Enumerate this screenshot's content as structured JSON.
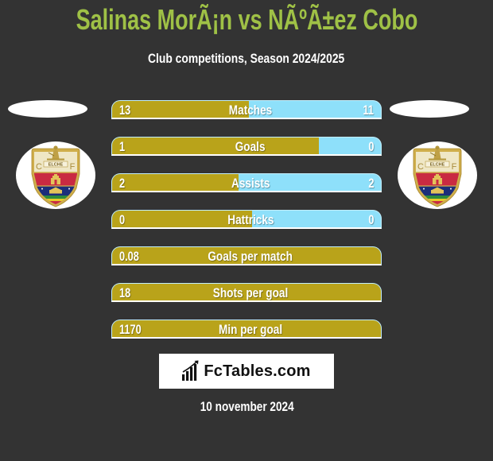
{
  "header": {
    "title": "Salinas MorÃ¡n vs NÃºÃ±ez Cobo",
    "subtitle": "Club competitions, Season 2024/2025"
  },
  "colors": {
    "background": "#333333",
    "title": "#9fc146",
    "left_bar": "#b9a31a",
    "right_bar": "#8ee0fa"
  },
  "teams": {
    "left": {
      "crest_icon": "elche-cf-crest-icon"
    },
    "right": {
      "crest_icon": "elche-cf-crest-icon"
    },
    "crest_text": {
      "left_letter": "C",
      "band": "ELCHE",
      "right_letter": "F"
    }
  },
  "stats": [
    {
      "label": "Matches",
      "left": "13",
      "right": "11",
      "left_fill": 0.51
    },
    {
      "label": "Goals",
      "left": "1",
      "right": "0",
      "left_fill": 0.77
    },
    {
      "label": "Assists",
      "left": "2",
      "right": "2",
      "left_fill": 0.47
    },
    {
      "label": "Hattricks",
      "left": "0",
      "right": "0",
      "left_fill": 0.52
    },
    {
      "label": "Goals per match",
      "left": "0.08",
      "right": null,
      "left_fill": 1
    },
    {
      "label": "Shots per goal",
      "left": "18",
      "right": null,
      "left_fill": 1
    },
    {
      "label": "Min per goal",
      "left": "1170",
      "right": null,
      "left_fill": 1
    }
  ],
  "branding": {
    "logo_text": "FcTables.com",
    "logo_icon": "bar-chart-growth-icon"
  },
  "footer": {
    "date": "10 november 2024"
  }
}
